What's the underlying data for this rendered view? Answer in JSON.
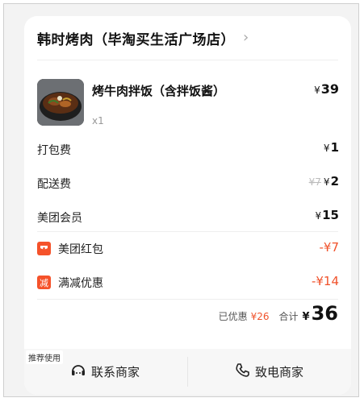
{
  "store": {
    "name": "韩时烤肉（毕淘买生活广场店）",
    "chevron": "›"
  },
  "item": {
    "name": "烤牛肉拌饭（含拌饭酱）",
    "qty": "x1",
    "price_symbol": "¥",
    "price": "39"
  },
  "fees": [
    {
      "label": "打包费",
      "symbol": "¥",
      "value": "1",
      "original": ""
    },
    {
      "label": "配送费",
      "symbol": "¥",
      "value": "2",
      "original": "¥7"
    },
    {
      "label": "美团会员",
      "symbol": "¥",
      "value": "15",
      "original": ""
    }
  ],
  "discounts": [
    {
      "label": "美团红包",
      "value": "-¥7",
      "icon": "red-packet-icon",
      "badge": "▬"
    },
    {
      "label": "满减优惠",
      "value": "-¥14",
      "icon": "discount-icon",
      "badge": "减"
    }
  ],
  "total": {
    "saved_label": "已优惠",
    "saved_value": "¥26",
    "sum_label": "合计",
    "symbol": "¥",
    "value": "36"
  },
  "bottom": {
    "recommend_tag": "推荐使用",
    "contact_label": "联系商家",
    "call_label": "致电商家",
    "contact_icon": "chat-headset-icon",
    "call_icon": "phone-icon"
  },
  "colors": {
    "accent": "#f5522a",
    "discount_text": "#f0522b"
  }
}
